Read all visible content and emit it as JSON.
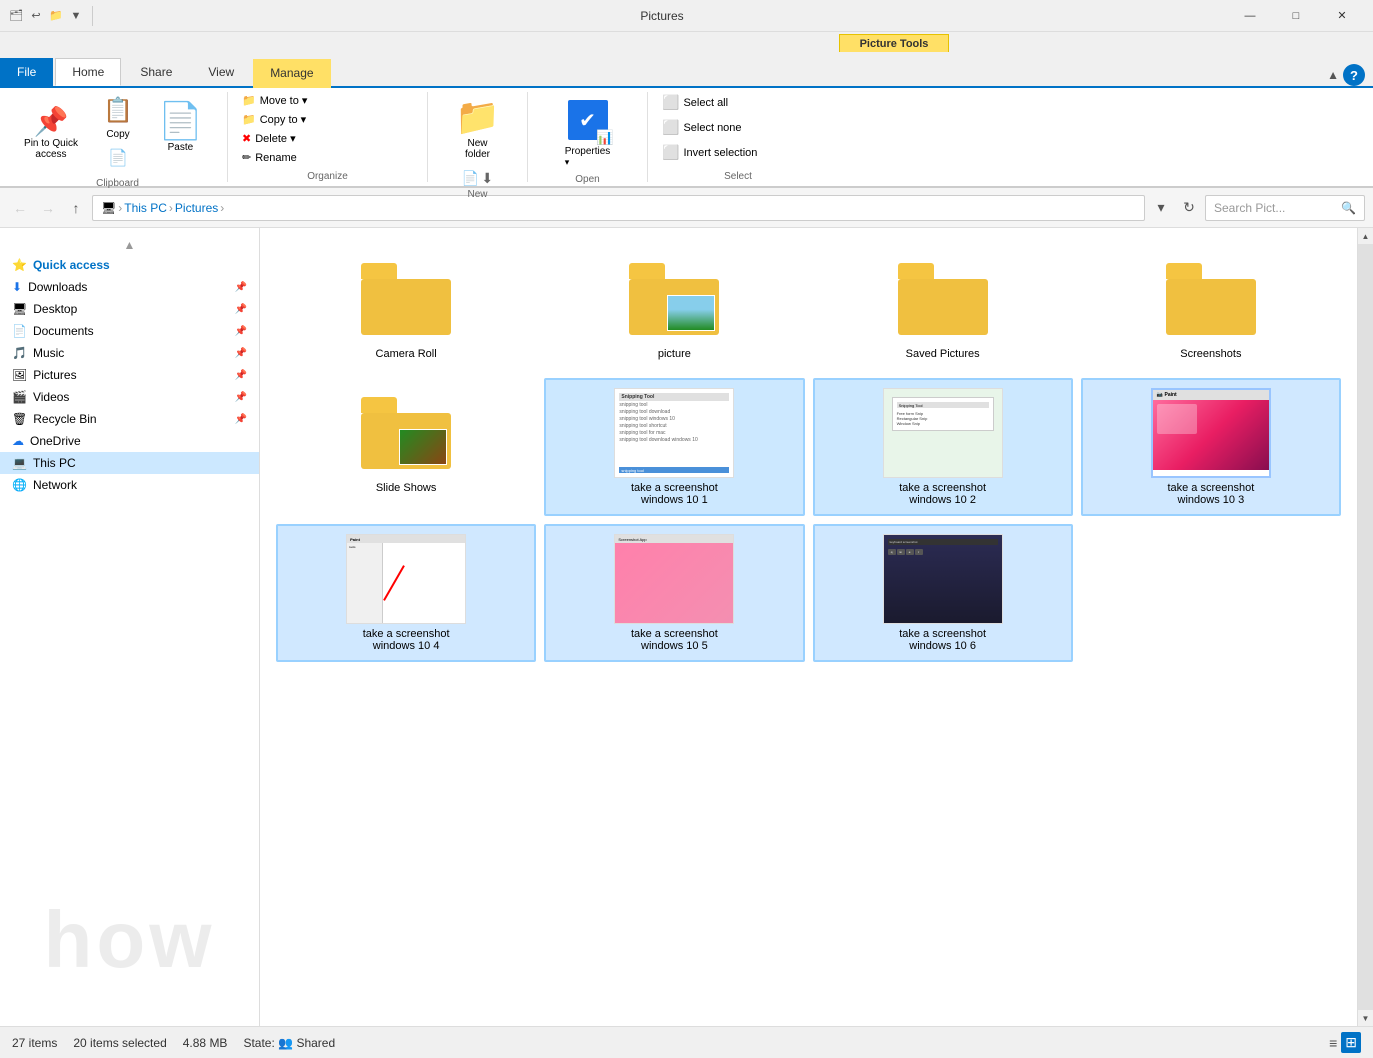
{
  "titlebar": {
    "title": "Pictures",
    "minimize": "—",
    "maximize": "□",
    "close": "✕"
  },
  "ribbon_tabs_top": {
    "picture_tools_label": "Picture Tools"
  },
  "tabs": [
    {
      "id": "file",
      "label": "File",
      "active": false
    },
    {
      "id": "home",
      "label": "Home",
      "active": true
    },
    {
      "id": "share",
      "label": "Share",
      "active": false
    },
    {
      "id": "view",
      "label": "View",
      "active": false
    },
    {
      "id": "manage",
      "label": "Manage",
      "active": false
    }
  ],
  "ribbon": {
    "sections": [
      {
        "id": "clipboard",
        "label": "Clipboard",
        "buttons": [
          {
            "id": "pin-quick-access",
            "label": "Pin to Quick\naccess",
            "icon": "📌"
          },
          {
            "id": "copy",
            "label": "Copy",
            "icon": "📋"
          },
          {
            "id": "paste",
            "label": "Paste",
            "icon": "📄"
          }
        ]
      },
      {
        "id": "organize",
        "label": "Organize",
        "buttons": [
          {
            "id": "move-to",
            "label": "Move to ▾",
            "icon": "📁"
          },
          {
            "id": "copy-to",
            "label": "Copy to ▾",
            "icon": "📁"
          },
          {
            "id": "delete",
            "label": "Delete ▾",
            "icon": "✖"
          },
          {
            "id": "rename",
            "label": "Rename",
            "icon": "✏"
          }
        ]
      },
      {
        "id": "new",
        "label": "New",
        "buttons": [
          {
            "id": "new-folder",
            "label": "New\nfolder",
            "icon": "📁"
          }
        ]
      },
      {
        "id": "open",
        "label": "Open",
        "buttons": [
          {
            "id": "properties",
            "label": "Properties",
            "icon": "✔"
          }
        ]
      },
      {
        "id": "select",
        "label": "Select",
        "buttons": [
          {
            "id": "select-all",
            "label": "Select all"
          },
          {
            "id": "select-none",
            "label": "Select none"
          },
          {
            "id": "invert-selection",
            "label": "Invert selection"
          }
        ]
      }
    ]
  },
  "address_bar": {
    "back_label": "←",
    "forward_label": "→",
    "up_label": "↑",
    "breadcrumb": [
      "This PC",
      "Pictures"
    ],
    "search_placeholder": "Search Pict..."
  },
  "sidebar": {
    "quick_access_label": "Quick access",
    "items": [
      {
        "id": "downloads",
        "label": "Downloads",
        "icon": "⬇",
        "pinned": true
      },
      {
        "id": "desktop",
        "label": "Desktop",
        "icon": "🖥",
        "pinned": true
      },
      {
        "id": "documents",
        "label": "Documents",
        "icon": "📄",
        "pinned": true
      },
      {
        "id": "music",
        "label": "Music",
        "icon": "🎵",
        "pinned": true
      },
      {
        "id": "pictures",
        "label": "Pictures",
        "icon": "🖼",
        "pinned": true
      },
      {
        "id": "videos",
        "label": "Videos",
        "icon": "🎬",
        "pinned": true
      },
      {
        "id": "recycle-bin",
        "label": "Recycle Bin",
        "icon": "🗑",
        "pinned": true
      },
      {
        "id": "onedrive",
        "label": "OneDrive",
        "icon": "☁"
      },
      {
        "id": "this-pc",
        "label": "This PC",
        "icon": "💻",
        "selected": true
      },
      {
        "id": "network",
        "label": "Network",
        "icon": "🌐"
      }
    ]
  },
  "files": [
    {
      "id": "camera-roll",
      "name": "Camera Roll",
      "type": "folder",
      "selected": false
    },
    {
      "id": "picture",
      "name": "picture",
      "type": "folder-photo",
      "selected": false
    },
    {
      "id": "saved-pictures",
      "name": "Saved Pictures",
      "type": "folder",
      "selected": false
    },
    {
      "id": "screenshots",
      "name": "Screenshots",
      "type": "folder",
      "selected": false
    },
    {
      "id": "slide-shows",
      "name": "Slide Shows",
      "type": "folder-photo2",
      "selected": false
    },
    {
      "id": "screenshot1",
      "name": "take a screenshot\nwindows 10 1",
      "type": "image1",
      "selected": true
    },
    {
      "id": "screenshot2",
      "name": "take a screenshot\nwindows 10 2",
      "type": "image2",
      "selected": true
    },
    {
      "id": "screenshot3",
      "name": "take a screenshot\nwindows 10 3",
      "type": "image3",
      "selected": true
    },
    {
      "id": "screenshot4",
      "name": "take a screenshot\nwindows 10 4",
      "type": "image4",
      "selected": true
    },
    {
      "id": "screenshot5",
      "name": "take a screenshot\nwindows 10 5",
      "type": "image5",
      "selected": true
    },
    {
      "id": "screenshot6",
      "name": "take a screenshot\nwindows 10 6",
      "type": "image6",
      "selected": true
    }
  ],
  "status_bar": {
    "item_count": "27 items",
    "selected_count": "20 items selected",
    "size": "4.88 MB",
    "state_label": "State:",
    "state_value": "Shared"
  }
}
